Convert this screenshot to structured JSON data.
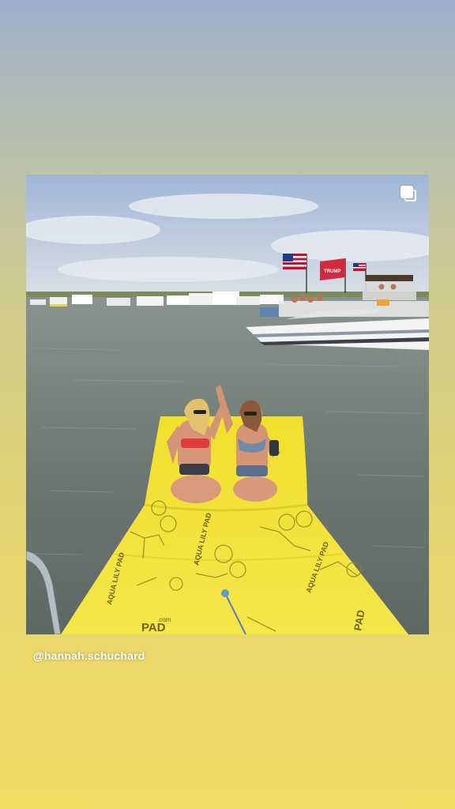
{
  "story": {
    "mention": "@hannah.schuchard",
    "post_icon": "multiple-images-icon"
  },
  "photo": {
    "flag_text": "TRUMP",
    "pad_brand": "AQUA LILY PAD",
    "pad_site": ".com",
    "pad_edge_text_left": "PAD",
    "pad_edge_text_right": "PAD",
    "colors": {
      "pad_yellow": "#f3e23a",
      "water": "#6f7a76",
      "sky": "#aebfd6"
    }
  }
}
